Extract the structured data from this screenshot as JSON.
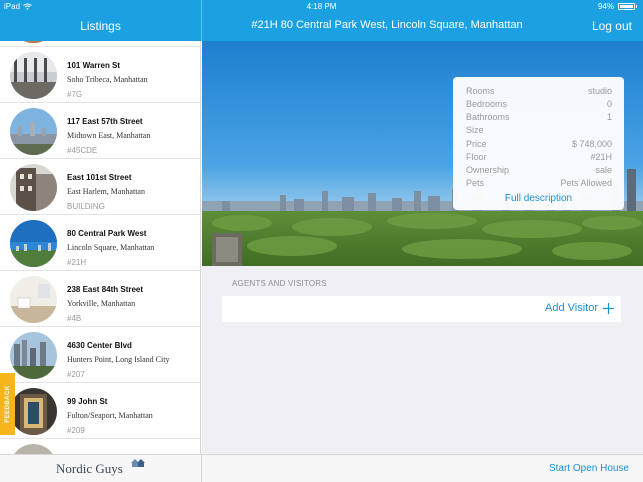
{
  "status_bar": {
    "carrier": "iPad",
    "time": "4:18 PM",
    "battery": "94%"
  },
  "nav": {
    "left_title": "Listings",
    "title": "#21H 80 Central Park West, Lincoln Square, Manhattan",
    "logout": "Log out"
  },
  "listings": [
    {
      "title": "101 Warren St",
      "area": "Soho Tribeca, Manhattan",
      "unit": "#7G"
    },
    {
      "title": "117 East 57th Street",
      "area": "Midtown East, Manhattan",
      "unit": "#45CDE"
    },
    {
      "title": "East 101st Street",
      "area": "East Harlem, Manhattan",
      "unit": "BUILDING"
    },
    {
      "title": "80 Central Park West",
      "area": "Lincoln Square, Manhattan",
      "unit": "#21H"
    },
    {
      "title": "238 East 84th Street",
      "area": "Yorkville, Manhattan",
      "unit": "#4B"
    },
    {
      "title": "4630 Center Blvd",
      "area": "Hunters Point, Long Island City",
      "unit": "#207"
    },
    {
      "title": "99 John St",
      "area": "Fulton/Seaport, Manhattan",
      "unit": "#209"
    }
  ],
  "feedback": "FEEDBACK",
  "details": [
    {
      "label": "Rooms",
      "value": "studio"
    },
    {
      "label": "Bedrooms",
      "value": "0"
    },
    {
      "label": "Bathrooms",
      "value": "1"
    },
    {
      "label": "Size",
      "value": ""
    },
    {
      "label": "Price",
      "value": "$ 748,000"
    },
    {
      "label": "Floor",
      "value": "#21H"
    },
    {
      "label": "Ownership",
      "value": "sale"
    },
    {
      "label": "Pets",
      "value": "Pets Allowed"
    }
  ],
  "full_description": "Full description",
  "agents_section": {
    "label": "AGENTS AND VISITORS",
    "add_visitor": "Add Visitor"
  },
  "footer": {
    "brand": "Nordic Guys",
    "start_open_house": "Start Open House"
  },
  "colors": {
    "accent": "#1ba1e2",
    "link": "#1a8fd8",
    "feedback": "#f6b519"
  }
}
